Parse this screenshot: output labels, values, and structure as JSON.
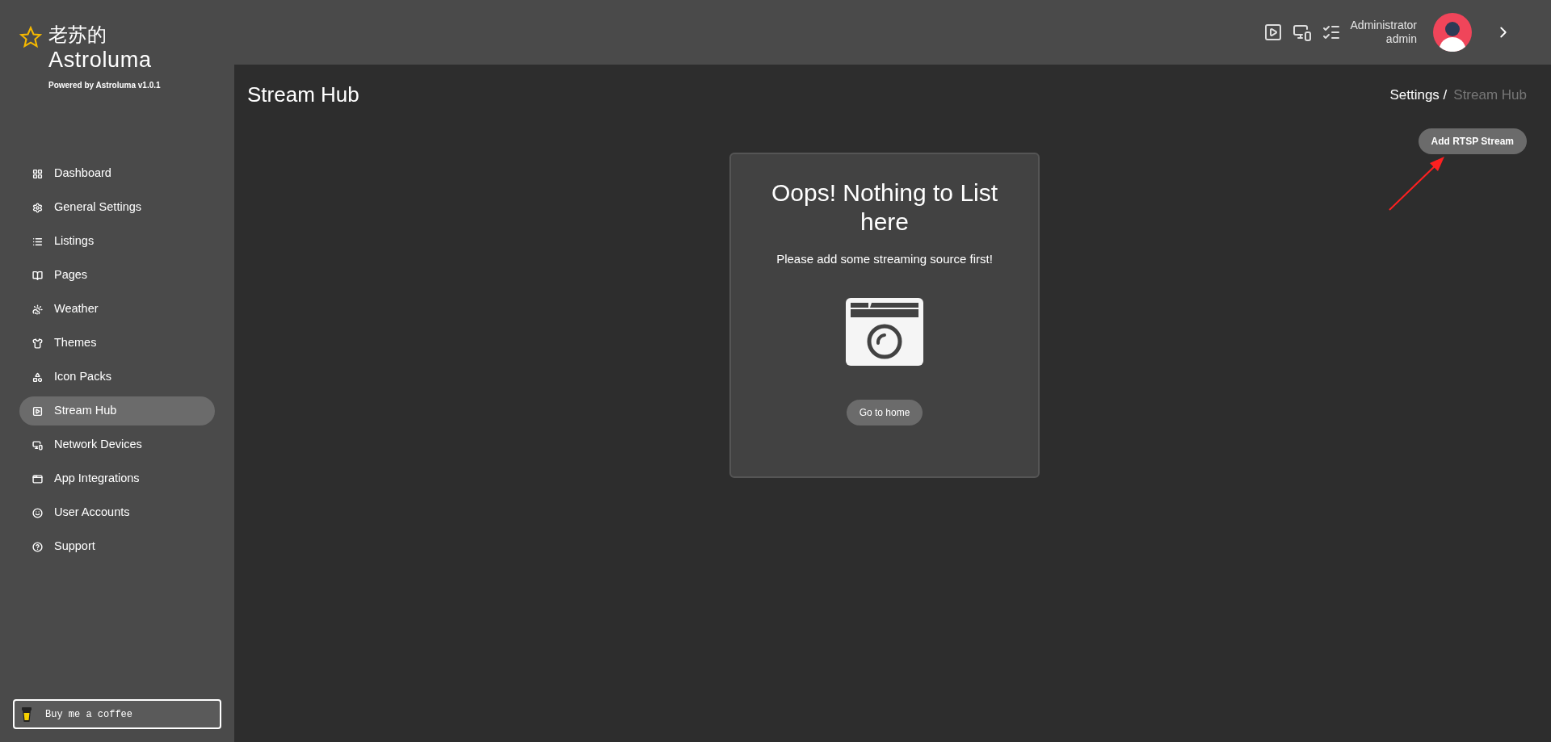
{
  "brand": {
    "title_line1": "老苏的",
    "title_line2": "Astroluma",
    "subtitle": "Powered by Astroluma v1.0.1"
  },
  "sidebar": {
    "items": [
      {
        "kind": "dashboard",
        "label": "Dashboard",
        "selected": false
      },
      {
        "kind": "settings",
        "label": "General Settings",
        "selected": false
      },
      {
        "kind": "listings",
        "label": "Listings",
        "selected": false
      },
      {
        "kind": "pages",
        "label": "Pages",
        "selected": false
      },
      {
        "kind": "weather",
        "label": "Weather",
        "selected": false
      },
      {
        "kind": "themes",
        "label": "Themes",
        "selected": false
      },
      {
        "kind": "icons",
        "label": "Icon Packs",
        "selected": false
      },
      {
        "kind": "stream",
        "label": "Stream Hub",
        "selected": true
      },
      {
        "kind": "devices",
        "label": "Network Devices",
        "selected": false
      },
      {
        "kind": "apps",
        "label": "App Integrations",
        "selected": false
      },
      {
        "kind": "users",
        "label": "User Accounts",
        "selected": false
      },
      {
        "kind": "support",
        "label": "Support",
        "selected": false
      }
    ],
    "coffee_button": "Buy me a coffee"
  },
  "header": {
    "user_name": "Administrator",
    "user_role": "admin"
  },
  "page": {
    "title": "Stream Hub",
    "breadcrumb": [
      {
        "label": "Settings /",
        "selected": false
      },
      {
        "label": "Stream Hub",
        "selected": true
      }
    ],
    "add_button": "Add RTSP Stream"
  },
  "empty_state": {
    "title": "Oops! Nothing to List here",
    "message": "Please add some streaming source first!",
    "button": "Go to home"
  }
}
